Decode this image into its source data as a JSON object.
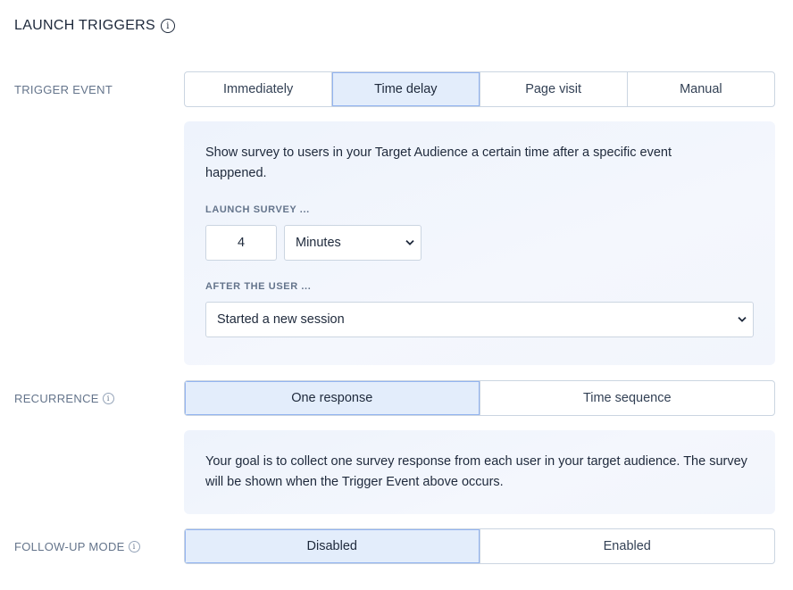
{
  "header": {
    "title": "LAUNCH TRIGGERS",
    "info_icon": "info-icon"
  },
  "trigger_event": {
    "label": "TRIGGER EVENT",
    "options": [
      {
        "label": "Immediately",
        "active": false
      },
      {
        "label": "Time delay",
        "active": true
      },
      {
        "label": "Page visit",
        "active": false
      },
      {
        "label": "Manual",
        "active": false
      }
    ],
    "panel": {
      "description": "Show survey to users in your Target Audience a certain time after a specific event happened.",
      "launch_label": "LAUNCH SURVEY ...",
      "delay_value": "4",
      "delay_unit": "Minutes",
      "after_label": "AFTER THE USER ...",
      "after_event": "Started a new session"
    }
  },
  "recurrence": {
    "label": "RECURRENCE",
    "options": [
      {
        "label": "One response",
        "active": true
      },
      {
        "label": "Time sequence",
        "active": false
      }
    ],
    "description": "Your goal is to collect one survey response from each user in your target audience. The survey will be shown when the Trigger Event above occurs."
  },
  "follow_up": {
    "label": "FOLLOW-UP MODE",
    "options": [
      {
        "label": "Disabled",
        "active": true
      },
      {
        "label": "Enabled",
        "active": false
      }
    ]
  },
  "colors": {
    "active_bg": "#e3edfb",
    "active_border": "#93b4f0",
    "panel_bg": "#eef3fc"
  }
}
